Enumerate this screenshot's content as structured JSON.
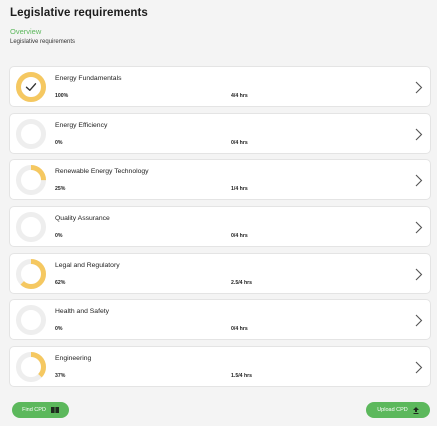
{
  "header": {
    "title": "Legislative requirements",
    "overview_link": "Overview",
    "subtitle": "Legislative requirements"
  },
  "colors": {
    "accent": "#5cb85c",
    "progress": "#f5c861",
    "track": "#eeeeee"
  },
  "modules": [
    {
      "title": "Energy Fundamentals",
      "percent_label": "100%",
      "hours_label": "4/4 hrs",
      "progress": 1.0,
      "complete": true
    },
    {
      "title": "Energy Efficiency",
      "percent_label": "0%",
      "hours_label": "0/4 hrs",
      "progress": 0.0,
      "complete": false
    },
    {
      "title": "Renewable Energy Technology",
      "percent_label": "25%",
      "hours_label": "1/4 hrs",
      "progress": 0.25,
      "complete": false
    },
    {
      "title": "Quality Assurance",
      "percent_label": "0%",
      "hours_label": "0/4 hrs",
      "progress": 0.0,
      "complete": false
    },
    {
      "title": "Legal and Regulatory",
      "percent_label": "62%",
      "hours_label": "2.5/4 hrs",
      "progress": 0.62,
      "complete": false
    },
    {
      "title": "Health and Safety",
      "percent_label": "0%",
      "hours_label": "0/4 hrs",
      "progress": 0.0,
      "complete": false
    },
    {
      "title": "Engineering",
      "percent_label": "37%",
      "hours_label": "1.5/4 hrs",
      "progress": 0.37,
      "complete": false
    }
  ],
  "footer": {
    "find_label": "Find CPD",
    "find_icon": "book-icon",
    "upload_label": "Upload CPD",
    "upload_icon": "upload-icon"
  }
}
